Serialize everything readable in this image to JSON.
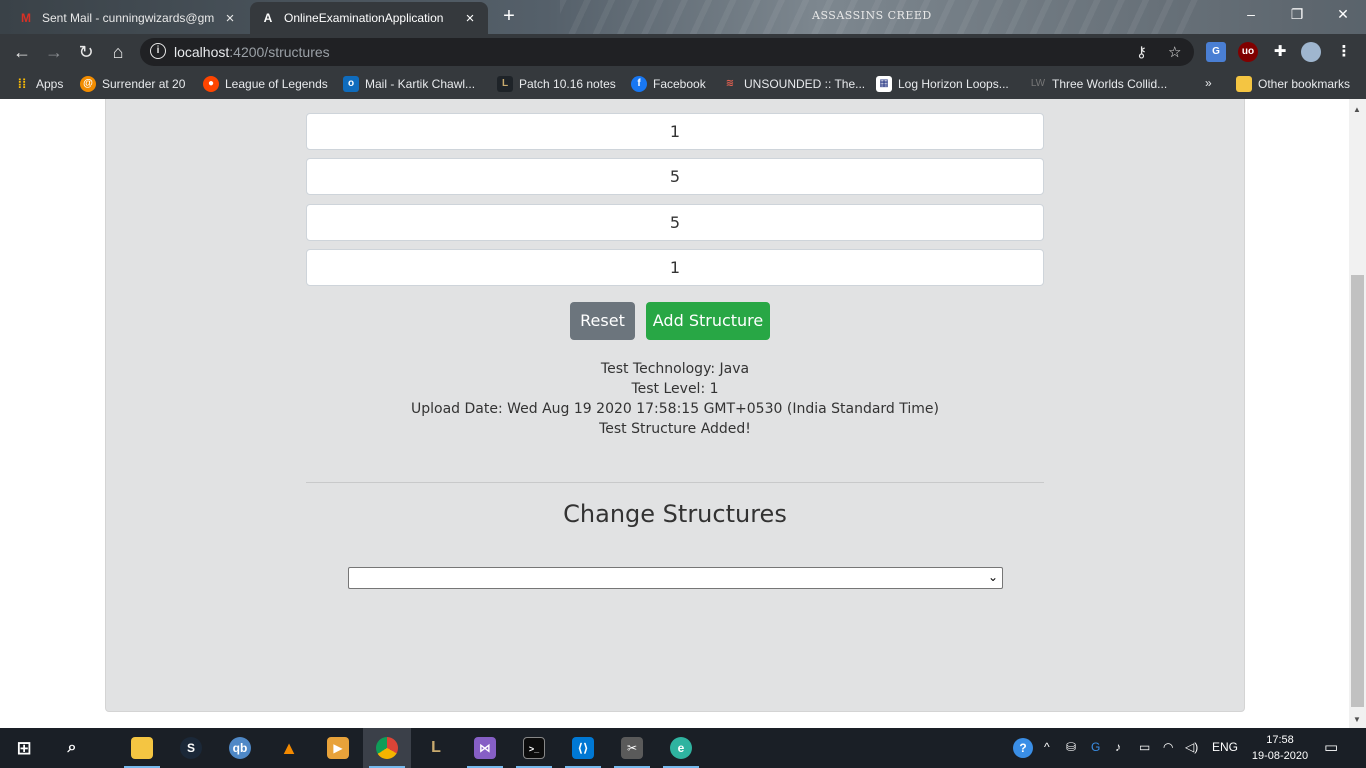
{
  "browser": {
    "tabs": [
      {
        "title": "Sent Mail - cunningwizards@gm",
        "icon": "gmail-icon",
        "active": false
      },
      {
        "title": "OnlineExaminationApplication",
        "icon": "angular-icon",
        "active": true
      }
    ],
    "theme_logo": "ASSASSINS CREED",
    "url_host": "localhost",
    "url_path": ":4200/structures",
    "bookmarks": [
      {
        "label": "Apps",
        "icon": "apps-grid-icon"
      },
      {
        "label": "Surrender at 20",
        "icon": "surrender-icon"
      },
      {
        "label": "League of Legends",
        "icon": "reddit-icon"
      },
      {
        "label": "Mail - Kartik Chawl...",
        "icon": "outlook-icon"
      },
      {
        "label": "Patch 10.16 notes",
        "icon": "league-icon"
      },
      {
        "label": "Facebook",
        "icon": "facebook-icon"
      },
      {
        "label": "UNSOUNDED :: The...",
        "icon": "unsounded-icon"
      },
      {
        "label": "Log Horizon Loops...",
        "icon": "loghorizon-icon"
      },
      {
        "label": "Three Worlds Collid...",
        "icon": "lw-icon"
      }
    ],
    "overflow_label": "»",
    "other_bookmarks": "Other bookmarks"
  },
  "form": {
    "fields": [
      "1",
      "5",
      "5",
      "1"
    ],
    "reset_label": "Reset",
    "add_label": "Add Structure"
  },
  "result": {
    "technology": "Test Technology: Java",
    "level": "Test Level: 1",
    "upload_date": "Upload Date: Wed Aug 19 2020 17:58:15 GMT+0530 (India Standard Time)",
    "message": "Test Structure Added!"
  },
  "change": {
    "heading": "Change Structures",
    "selected": ""
  },
  "taskbar": {
    "apps": [
      "windows-start-icon",
      "search-icon",
      "file-explorer-icon",
      "steam-icon",
      "qbittorrent-icon",
      "vlc-icon",
      "media-player-icon",
      "chrome-icon",
      "league-client-icon",
      "visual-studio-icon",
      "terminal-icon",
      "vscode-icon",
      "tools-icon",
      "edge-icon"
    ],
    "language": "ENG",
    "time": "17:58",
    "date": "19-08-2020"
  },
  "colors": {
    "reset_button": "#6c757d",
    "add_button": "#28a745",
    "card_background": "#e1e2e3"
  }
}
